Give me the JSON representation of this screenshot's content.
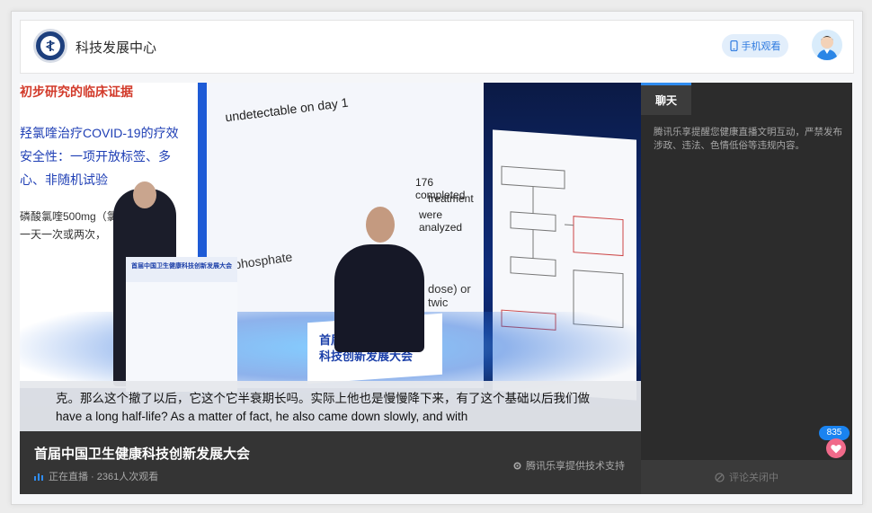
{
  "header": {
    "site_title": "科技发展中心",
    "mobile_button_label": "手机观看"
  },
  "video": {
    "left_screen_lines": [
      "初步研究的临床证据",
      "羟氯喹治疗COVID-19的疗效",
      "安全性：一项开放标签、多",
      "心、非随机试验",
      "磷酸氯喹500mg（氯",
      "一天一次或两次，"
    ],
    "mid_screen_lines": [
      "undetectable on day 1",
      "176 completed",
      "treatment",
      "were analyzed",
      "phosphate",
      "dose) or twic"
    ],
    "stage_sign": "首届中国卫生健康科技创新发展大会",
    "podium_sign": "首届中国卫生健康科技创新发展大会",
    "subtitle_zh": "克。那么这个撤了以后，它这个它半衰期长吗。实际上他也是慢慢降下来，有了这个基础以后我们做",
    "subtitle_en": "have a long half-life? As a matter of fact, he also came down slowly, and with"
  },
  "info": {
    "event_title": "首届中国卫生健康科技创新发展大会",
    "live_status": "正在直播 · 2361人次观看",
    "powered_by": "腾讯乐享提供技术支持"
  },
  "chat": {
    "tab_label": "聊天",
    "notice": "腾讯乐享提醒您健康直播文明互动，严禁发布涉政、违法、色情低俗等违规内容。",
    "like_count": "835",
    "comments_closed": "评论关闭中"
  },
  "colors": {
    "accent": "#2f8cf0",
    "like_pink": "#f06a8a",
    "info_bar": "#343434",
    "chat_bg": "#2c2c2c"
  },
  "icons": {
    "mobile": "phone-icon",
    "live": "bars-icon",
    "powered": "gear-icon",
    "like": "heart-icon",
    "closed": "ban-icon"
  }
}
